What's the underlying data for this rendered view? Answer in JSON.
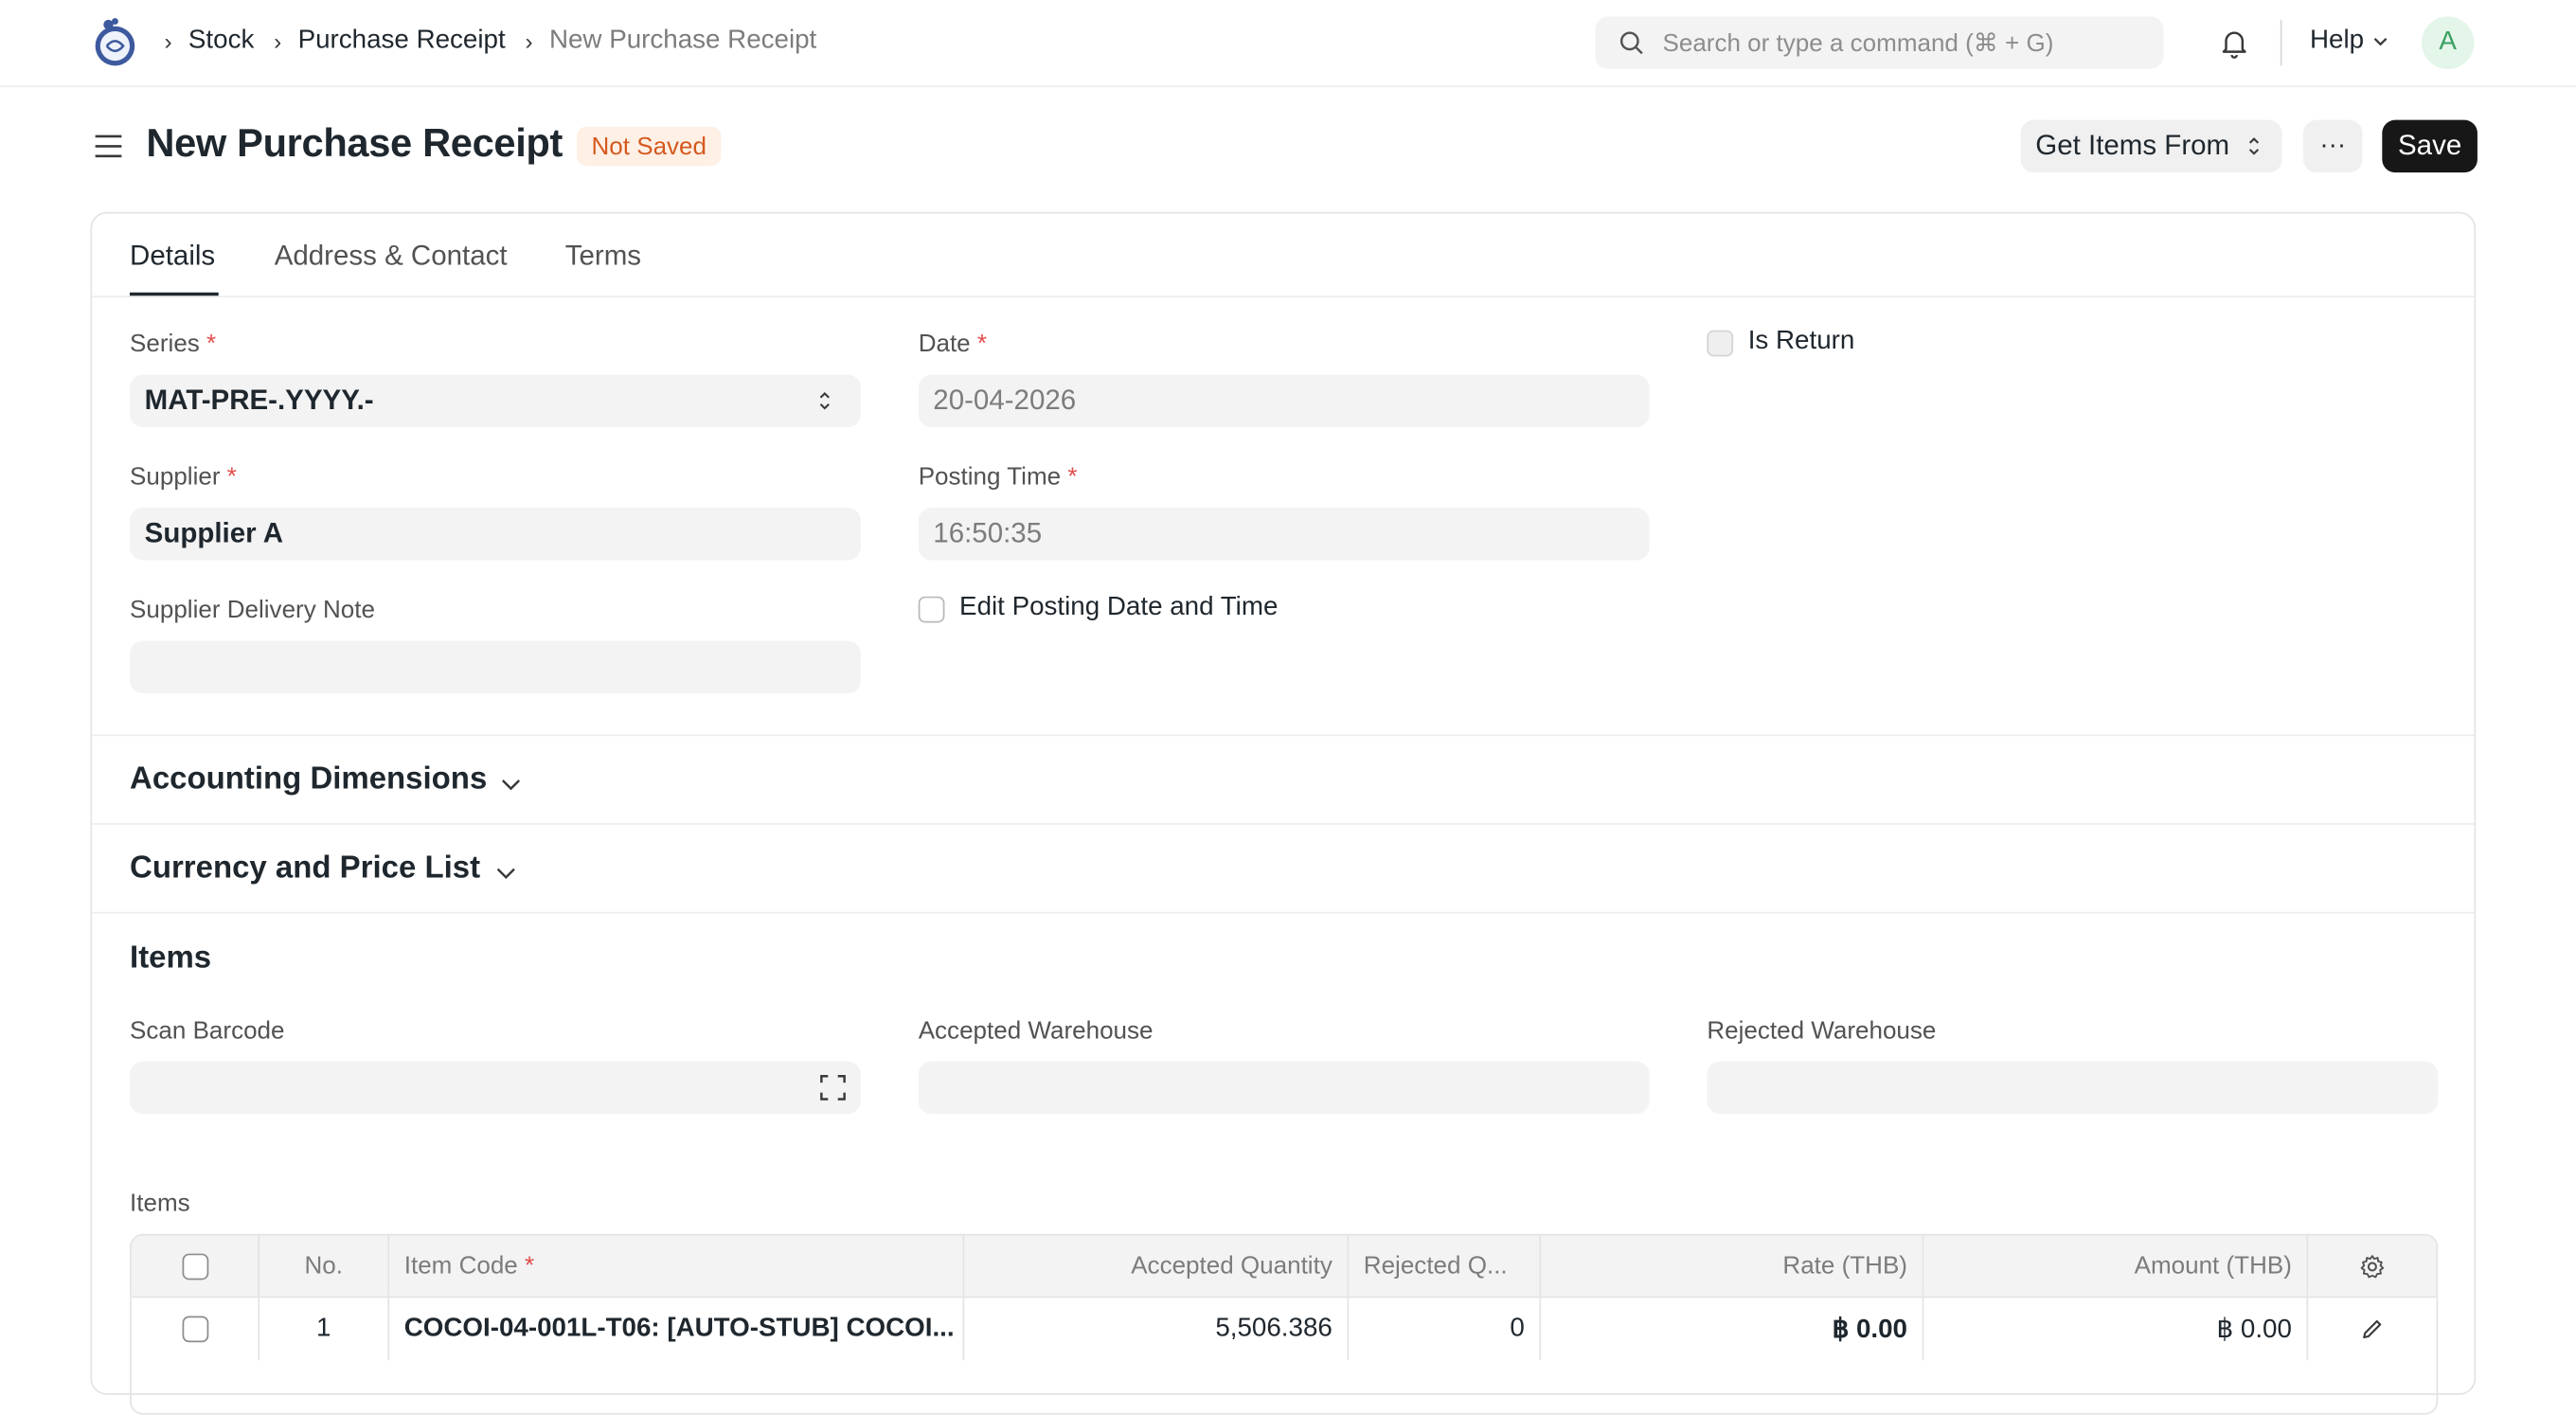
{
  "navbar": {
    "breadcrumbs": [
      "Stock",
      "Purchase Receipt",
      "New Purchase Receipt"
    ],
    "search_placeholder": "Search or type a command (⌘ + G)",
    "help_label": "Help",
    "avatar_initial": "A"
  },
  "page": {
    "title": "New Purchase Receipt",
    "status_badge": "Not Saved",
    "get_items_label": "Get Items From",
    "more_label": "···",
    "save_label": "Save"
  },
  "tabs": [
    "Details",
    "Address & Contact",
    "Terms"
  ],
  "details": {
    "series_label": "Series",
    "series_value": "MAT-PRE-.YYYY.-",
    "date_label": "Date",
    "date_value": "20-04-2026",
    "is_return_label": "Is Return",
    "supplier_label": "Supplier",
    "supplier_value": "Supplier A",
    "posting_time_label": "Posting Time",
    "posting_time_value": "16:50:35",
    "supplier_delivery_note_label": "Supplier Delivery Note",
    "supplier_delivery_note_value": "",
    "edit_posting_label": "Edit Posting Date and Time"
  },
  "sections": {
    "accounting_dimensions": "Accounting Dimensions",
    "currency_price_list": "Currency and Price List",
    "items": "Items"
  },
  "items_section": {
    "scan_barcode_label": "Scan Barcode",
    "accepted_warehouse_label": "Accepted Warehouse",
    "rejected_warehouse_label": "Rejected Warehouse",
    "table_label": "Items"
  },
  "items_table": {
    "columns": [
      "No.",
      "Item Code",
      "Accepted Quantity",
      "Rejected Q...",
      "Rate (THB)",
      "Amount (THB)"
    ],
    "rows": [
      {
        "no": "1",
        "item_code": "COCOI-04-001L-T06: [AUTO-STUB] COCOI...",
        "accepted_qty": "5,506.386",
        "rejected_qty": "0",
        "rate": "฿ 0.00",
        "amount": "฿ 0.00"
      }
    ]
  },
  "colors": {
    "accent_dark": "#171717",
    "badge_bg": "#fff0e6",
    "badge_text": "#d45a1e",
    "required": "#e24c4c"
  },
  "icons": [
    "app-logo-icon",
    "chevron-right-icon",
    "search-icon",
    "bell-icon",
    "chevron-down-icon",
    "menu-icon",
    "sort-arrows-icon",
    "scan-icon",
    "gear-icon",
    "pencil-icon"
  ]
}
